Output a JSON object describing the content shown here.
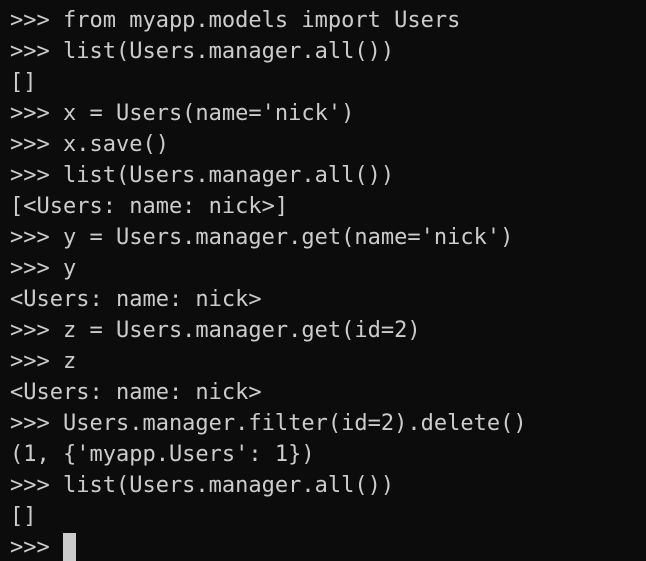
{
  "terminal": {
    "colors": {
      "background": "#0c0c0c",
      "foreground": "#cccccc",
      "cursor": "#cccccc"
    },
    "lines": [
      ">>> from myapp.models import Users",
      ">>> list(Users.manager.all())",
      "[]",
      ">>> x = Users(name='nick')",
      ">>> x.save()",
      ">>> list(Users.manager.all())",
      "[<Users: name: nick>]",
      ">>> y = Users.manager.get(name='nick')",
      ">>> y",
      "<Users: name: nick>",
      ">>> z = Users.manager.get(id=2)",
      ">>> z",
      "<Users: name: nick>",
      ">>> Users.manager.filter(id=2).delete()",
      "(1, {'myapp.Users': 1})",
      ">>> list(Users.manager.all())",
      "[]"
    ],
    "prompt": ">>> "
  }
}
